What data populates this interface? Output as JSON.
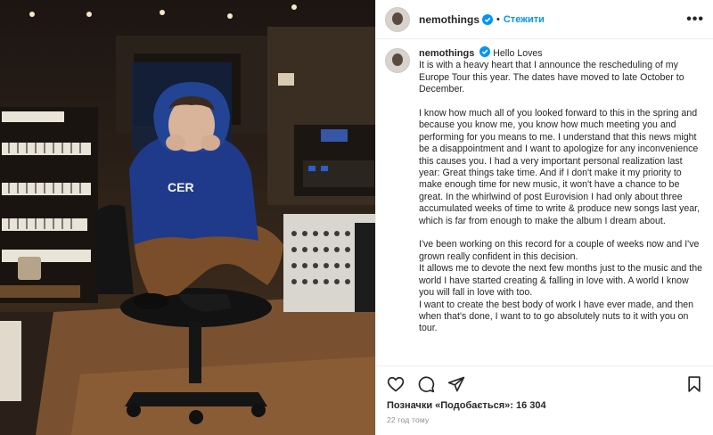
{
  "post": {
    "username": "nemothings",
    "follow_label": "Стежити",
    "more_label": "•••",
    "separator": "•",
    "caption": {
      "title": "Hello Loves",
      "paragraphs": [
        "It is with a heavy heart that I announce the rescheduling of my Europe Tour this year. The dates have moved to late October to December.",
        "I know how much all of you looked forward to this in the spring and because you know me, you know how much meeting you and performing for you means to me. I understand that this news might be a disappointment and I want to apologize for any inconvenience this causes you. I had a very important personal realization last year: Great things take time. And if I don't make it my priority to make enough time for new music, it won't have a chance to be great. In the whirlwind of post Eurovision I had only about three accumulated weeks of time to write & produce new songs last year, which is far from enough to make the album I dream about.",
        "I've been working on this record for a couple of weeks now and I've grown really confident in this decision.",
        "It allows me to devote the next few months just to the music and the world I have started creating & falling in love with. A world I know you will fall in love with too.",
        "I want to create the best body of work I have ever made, and then when that's done, I want to to go absolutely nuts to it with you on tour."
      ]
    },
    "likes_text": "Позначки «Подобається»: 16 304",
    "time_text": "22 год тому"
  },
  "icons": {
    "verified": "verified-badge-icon",
    "like": "heart-icon",
    "comment": "comment-icon",
    "share": "paper-plane-icon",
    "save": "bookmark-icon"
  },
  "colors": {
    "accent": "#0095f6",
    "text": "#262626",
    "muted": "#8e8e8e",
    "hoodie": "#1f3a8a"
  }
}
